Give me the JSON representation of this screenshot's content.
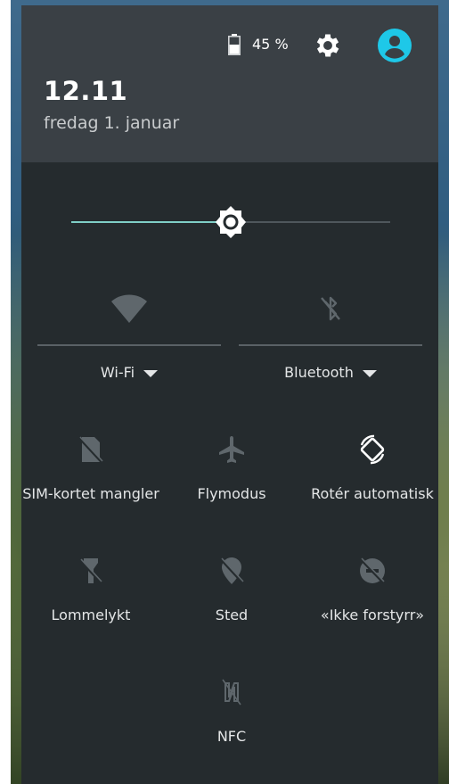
{
  "status": {
    "battery_percent": "45 %",
    "time": "12.11",
    "date": "fredag 1. januar"
  },
  "brightness": {
    "level": 0.5
  },
  "connectivity": [
    {
      "label": "Wi-Fi",
      "icon": "wifi-icon"
    },
    {
      "label": "Bluetooth",
      "icon": "bluetooth-off-icon"
    }
  ],
  "tiles": [
    {
      "label": "SIM-kortet mangler",
      "icon": "sim-missing-icon",
      "active": false
    },
    {
      "label": "Flymodus",
      "icon": "airplane-icon",
      "active": false
    },
    {
      "label": "Rotér automatisk",
      "icon": "auto-rotate-icon",
      "active": true
    },
    {
      "label": "Lommelykt",
      "icon": "flashlight-off-icon",
      "active": false
    },
    {
      "label": "Sted",
      "icon": "location-off-icon",
      "active": false
    },
    {
      "label": "«Ikke forstyrr»",
      "icon": "do-not-disturb-off-icon",
      "active": false
    },
    {
      "label": "NFC",
      "icon": "nfc-icon",
      "active": false
    }
  ],
  "colors": {
    "panel": "#252b2e",
    "header": "#3a4045",
    "accent": "#7fcfc7",
    "avatar": "#1ec8e8",
    "inactive_icon": "#5f676c",
    "active_icon": "#ffffff"
  }
}
